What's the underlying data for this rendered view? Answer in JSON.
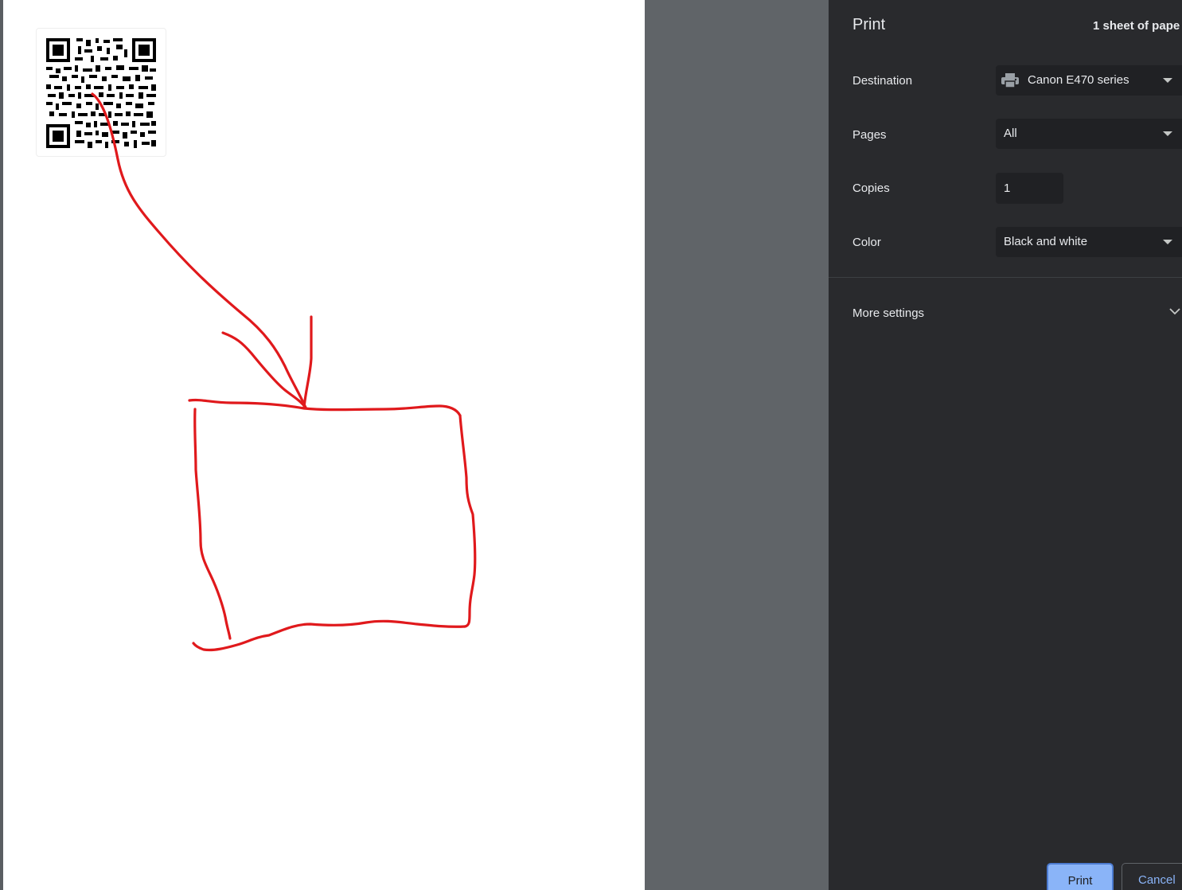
{
  "panel": {
    "title": "Print",
    "sheet_count": "1 sheet of pape"
  },
  "settings": {
    "destination": {
      "label": "Destination",
      "value": "Canon E470 series",
      "icon": "printer-icon"
    },
    "pages": {
      "label": "Pages",
      "value": "All"
    },
    "copies": {
      "label": "Copies",
      "value": "1"
    },
    "color": {
      "label": "Color",
      "value": "Black and white"
    }
  },
  "more_settings": {
    "label": "More settings",
    "icon": "chevron-down-icon"
  },
  "actions": {
    "print_label": "Print",
    "cancel_label": "Cancel"
  },
  "colors": {
    "panel_bg": "#292a2d",
    "field_bg": "#202124",
    "accent": "#8ab4f8",
    "drawing_stroke": "#e0191c"
  }
}
